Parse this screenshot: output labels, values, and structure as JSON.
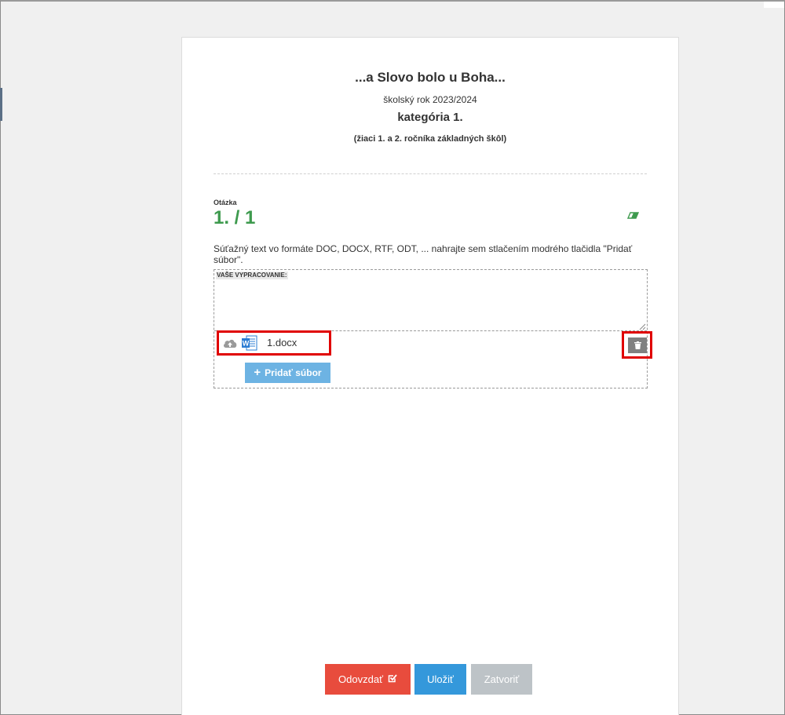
{
  "header": {
    "title": "...a Slovo bolo u Boha...",
    "school_year": "školský rok 2023/2024",
    "category": "kategória 1.",
    "category_note": "(žiaci 1. a 2. ročníka základných škôl)"
  },
  "question": {
    "label": "Otázka",
    "number": "1. / 1",
    "instructions": "Súťažný text vo formáte DOC, DOCX, RTF, ODT, ... nahrajte sem stlačením modrého tlačidla \"Pridať súbor\"."
  },
  "answer": {
    "label": "VAŠE VYPRACOVANIE:",
    "value": "",
    "file_name": "1.docx",
    "add_file_label": "Pridať súbor"
  },
  "colors": {
    "accent_green": "#3e9a4e",
    "highlight_red": "#e00000",
    "submit_red": "#e84c3d",
    "save_blue": "#3498db",
    "add_file_blue": "#6db3e3",
    "close_gray": "#bdc3c7"
  },
  "icons": {
    "eraser": "eraser-icon",
    "upload": "cloud-upload-icon",
    "word": "word-file-icon",
    "delete": "trash-icon",
    "add": "plus-icon",
    "submit": "check-square-icon"
  },
  "footer": {
    "submit_label": "Odovzdať",
    "save_label": "Uložiť",
    "close_label": "Zatvoriť"
  }
}
